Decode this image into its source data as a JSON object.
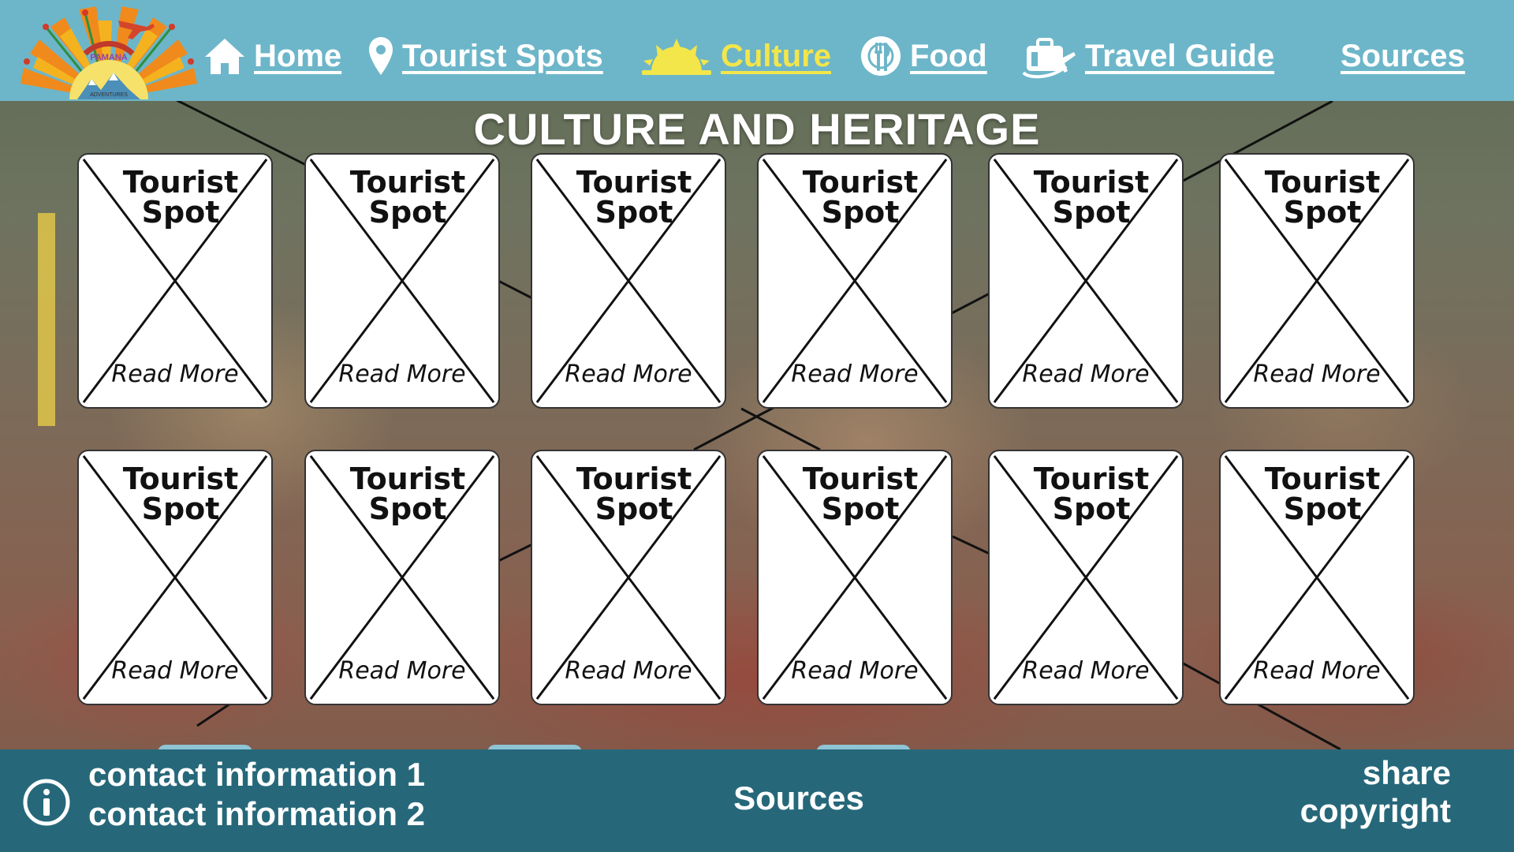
{
  "nav": {
    "home": "Home",
    "tourist_spots": "Tourist Spots",
    "culture": "Culture",
    "food": "Food",
    "travel_guide": "Travel Guide",
    "sources": "Sources"
  },
  "page_title": "CULTURE AND HERITAGE",
  "cards": [
    {
      "title_line1": "Tourist",
      "title_line2": "Spot",
      "more": "Read More"
    },
    {
      "title_line1": "Tourist",
      "title_line2": "Spot",
      "more": "Read More"
    },
    {
      "title_line1": "Tourist",
      "title_line2": "Spot",
      "more": "Read More"
    },
    {
      "title_line1": "Tourist",
      "title_line2": "Spot",
      "more": "Read More"
    },
    {
      "title_line1": "Tourist",
      "title_line2": "Spot",
      "more": "Read More"
    },
    {
      "title_line1": "Tourist",
      "title_line2": "Spot",
      "more": "Read More"
    },
    {
      "title_line1": "Tourist",
      "title_line2": "Spot",
      "more": "Read More"
    },
    {
      "title_line1": "Tourist",
      "title_line2": "Spot",
      "more": "Read More"
    },
    {
      "title_line1": "Tourist",
      "title_line2": "Spot",
      "more": "Read More"
    },
    {
      "title_line1": "Tourist",
      "title_line2": "Spot",
      "more": "Read More"
    },
    {
      "title_line1": "Tourist",
      "title_line2": "Spot",
      "more": "Read More"
    },
    {
      "title_line1": "Tourist",
      "title_line2": "Spot",
      "more": "Read More"
    }
  ],
  "footer": {
    "contact_1": "contact information 1",
    "contact_2": "contact information 2",
    "sources": "Sources",
    "share": "share",
    "copyright": "copyright"
  },
  "colors": {
    "header_bg": "#6db6c9",
    "footer_bg": "#26687a",
    "nav_text": "#ffffff",
    "nav_active": "#f3e64a"
  },
  "icons": {
    "home": "home-icon",
    "tourist_spots": "map-pin-icon",
    "culture": "sun-icon",
    "food": "plate-cutlery-icon",
    "travel_guide": "suitcase-plane-icon",
    "footer_info": "info-icon"
  }
}
